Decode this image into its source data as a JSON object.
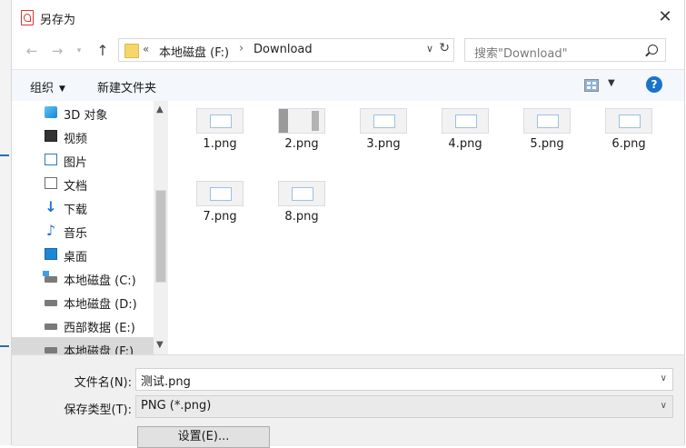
{
  "window": {
    "title": "另存为",
    "close_glyph": "✕"
  },
  "address": {
    "overflow": "«",
    "crumbs": [
      "本地磁盘 (F:)",
      "Download"
    ],
    "search_placeholder": "搜索\"Download\""
  },
  "toolbar": {
    "organize": "组织",
    "new_folder": "新建文件夹",
    "help_glyph": "?"
  },
  "nav_items": [
    {
      "label": "3D 对象",
      "icon": "3d-objects-icon"
    },
    {
      "label": "视频",
      "icon": "video-icon"
    },
    {
      "label": "图片",
      "icon": "pictures-icon"
    },
    {
      "label": "文档",
      "icon": "documents-icon"
    },
    {
      "label": "下载",
      "icon": "download-icon"
    },
    {
      "label": "音乐",
      "icon": "music-icon"
    },
    {
      "label": "桌面",
      "icon": "desktop-icon"
    },
    {
      "label": "本地磁盘 (C:)",
      "icon": "drive-icon"
    },
    {
      "label": "本地磁盘 (D:)",
      "icon": "drive-icon"
    },
    {
      "label": "西部数据 (E:)",
      "icon": "drive-icon"
    },
    {
      "label": "本地磁盘 (F:)",
      "icon": "drive-icon",
      "selected": true
    }
  ],
  "files": [
    "1.png",
    "2.png",
    "3.png",
    "4.png",
    "5.png",
    "6.png",
    "7.png",
    "8.png"
  ],
  "form": {
    "filename_label": "文件名(N):",
    "filename_value": "测试.png",
    "type_label": "保存类型(T):",
    "type_value": "PNG (*.png)",
    "options_button": "设置(E)..."
  },
  "colors": {
    "accent": "#1a73c9",
    "selection": "#d9d9d9",
    "toolbar_bg": "#f4f7fb"
  }
}
